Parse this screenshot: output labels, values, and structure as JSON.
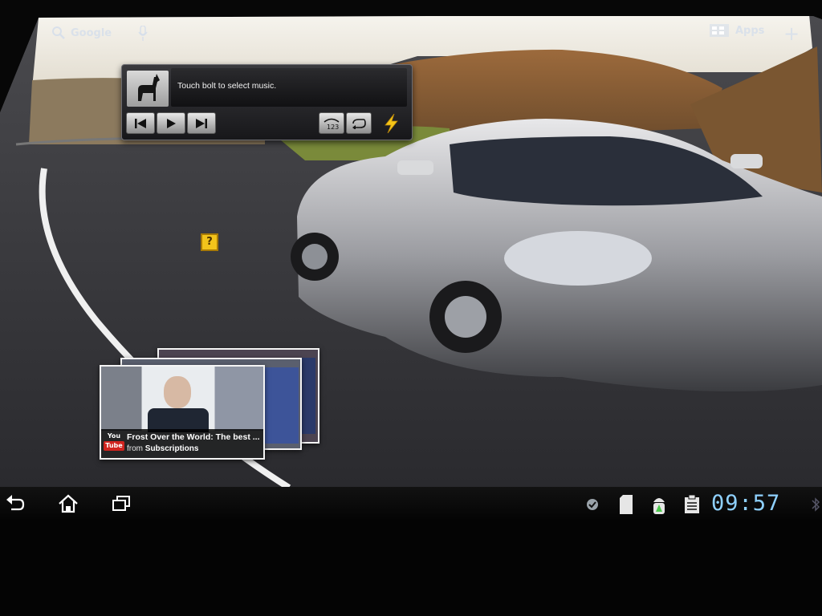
{
  "colors": {
    "accent": "#8fd1ff",
    "youtube_red": "#d1241f",
    "lightning": "#f5c518"
  },
  "topbar": {
    "search_label": "Google",
    "search_icon": "search-icon",
    "voice_icon": "microphone-icon",
    "apps_label": "Apps",
    "apps_icon": "apps-grid-icon",
    "add_icon": "plus-icon"
  },
  "music_widget": {
    "now_playing": "Touch bolt to select music.",
    "album_icon": "llama-icon",
    "controls": [
      "previous-icon",
      "play-icon",
      "next-icon"
    ],
    "modes": [
      "shuffle-123-icon",
      "repeat-icon"
    ],
    "select_icon": "lightning-bolt-icon"
  },
  "help": {
    "label": "?"
  },
  "youtube_widget": {
    "logo_you": "You",
    "logo_tube": "Tube",
    "video_title": "Frost Over the World: The best ...",
    "source_prefix": "from",
    "source_name": "Subscriptions"
  },
  "system_bar": {
    "nav": [
      "back-icon",
      "home-icon",
      "recent-apps-icon"
    ],
    "status_icons": [
      "check-notification-icon",
      "sd-card-icon",
      "android-usb-icon",
      "clipboard-icon",
      "bluetooth-icon"
    ],
    "clock": "09:57"
  }
}
